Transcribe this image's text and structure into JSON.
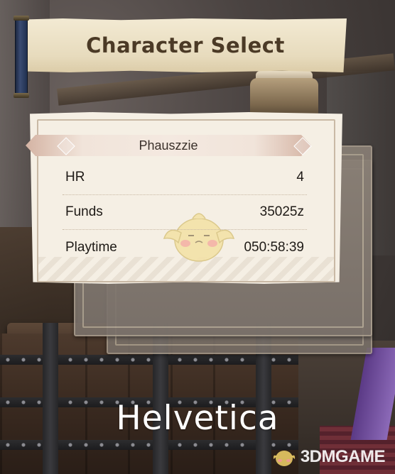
{
  "screen": {
    "title": "Character Select"
  },
  "character_card": {
    "name": "Phauszzie",
    "stats": [
      {
        "label": "HR",
        "value": "4"
      },
      {
        "label": "Funds",
        "value": "35025z"
      },
      {
        "label": "Playtime",
        "value": "050:58:39"
      }
    ]
  },
  "caption": "Helvetica",
  "watermark": {
    "text": "3DMGAME"
  },
  "colors": {
    "title_text": "#4b3a26",
    "card_bg": "#f5efe4",
    "banner_accent": "#d4b3a3",
    "scroll_rod": "#2c3a5e"
  }
}
